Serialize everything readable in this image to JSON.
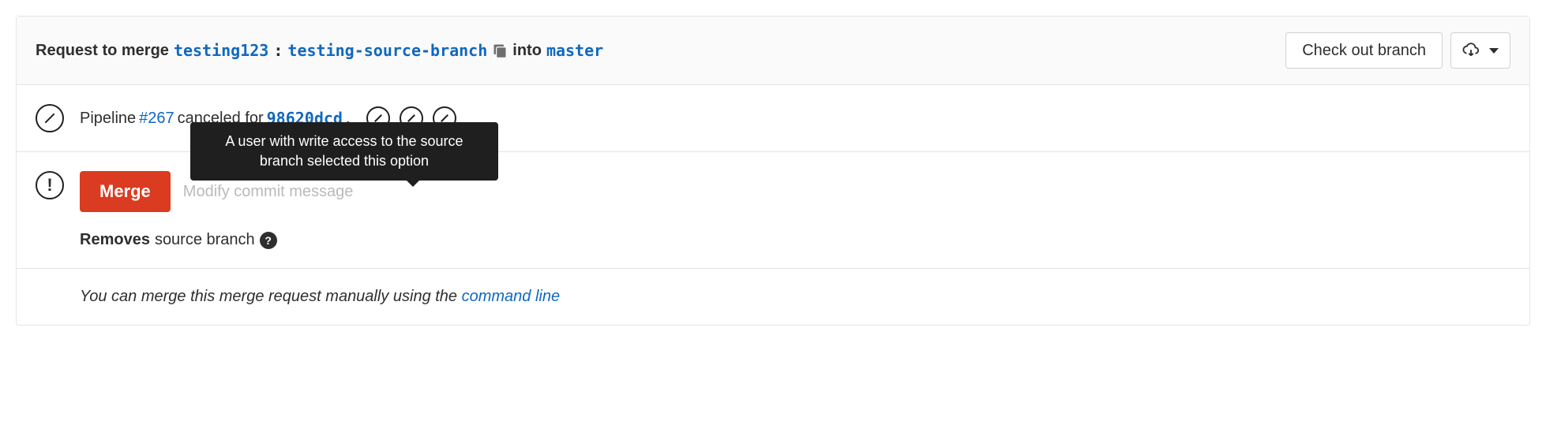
{
  "header": {
    "prefix": "Request to merge",
    "source_namespace": "testing123",
    "separator": ":",
    "source_branch": "testing-source-branch",
    "into_label": "into",
    "target_branch": "master",
    "checkout_button": "Check out branch"
  },
  "pipeline": {
    "label_prefix": "Pipeline",
    "pipeline_number": "#267",
    "canceled_label": "canceled for",
    "commit_sha": "98620dcd",
    "suffix": "."
  },
  "merge": {
    "merge_button": "Merge",
    "modify_commit_label": "Modify commit message",
    "tooltip_text": "A user with write access to the source branch selected this option",
    "removes_bold": "Removes",
    "removes_rest": "source branch",
    "help_char": "?"
  },
  "footer": {
    "text_prefix": "You can merge this merge request manually using the ",
    "link_text": "command line"
  }
}
